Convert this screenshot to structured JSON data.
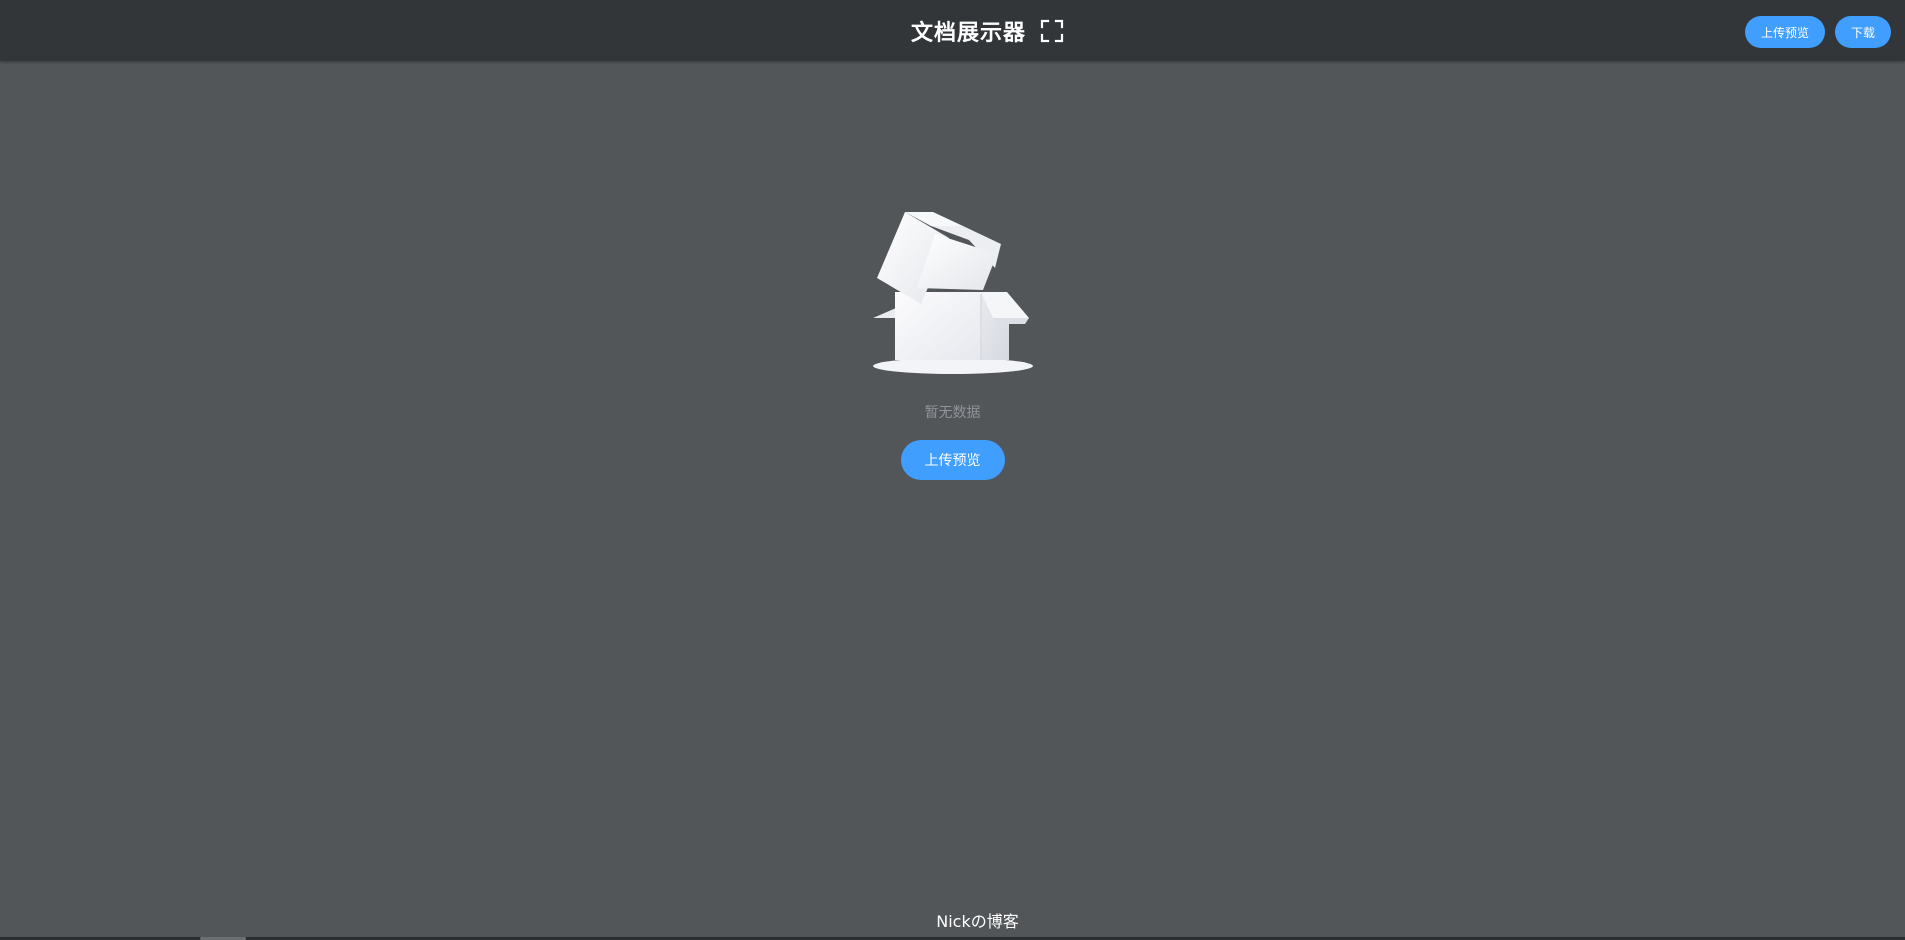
{
  "header": {
    "title": "文档展示器",
    "fullscreen_icon": "fullscreen-icon",
    "upload_label": "上传预览",
    "download_label": "下载"
  },
  "empty_state": {
    "illustration_icon": "empty-box-icon",
    "text": "暂无数据",
    "upload_label": "上传预览"
  },
  "footer": {
    "text": "Nickの博客"
  },
  "colors": {
    "header_bg": "#323639",
    "page_bg": "#525659",
    "accent": "#409eff",
    "empty_text": "#909399"
  }
}
